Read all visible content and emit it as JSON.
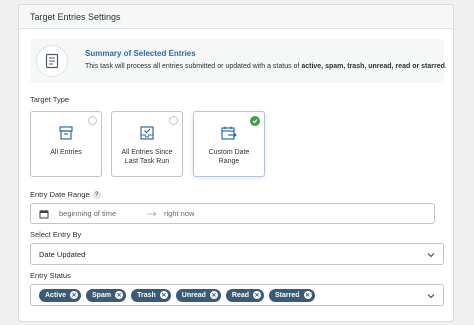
{
  "header": {
    "title": "Target Entries Settings"
  },
  "summary": {
    "title": "Summary of Selected Entries",
    "text_prefix": "This task will process all entries submitted or updated with a status of ",
    "statuses_text": "active, spam, trash, unread, read or starred",
    "text_suffix": "."
  },
  "target_type": {
    "label": "Target Type",
    "options": [
      {
        "label": "All Entries",
        "selected": false
      },
      {
        "label_line1": "All Entries Since",
        "label_line2": "Last Task Run",
        "selected": false
      },
      {
        "label": "Custom Date Range",
        "selected": true
      }
    ]
  },
  "date_range": {
    "label": "Entry Date Range",
    "help": "?",
    "start_placeholder": "beginning of time",
    "end_placeholder": "right now"
  },
  "select_entry_by": {
    "label": "Select Entry By",
    "value": "Date Updated"
  },
  "entry_status": {
    "label": "Entry Status",
    "tags": [
      "Active",
      "Spam",
      "Trash",
      "Unread",
      "Read",
      "Starred"
    ]
  },
  "colors": {
    "accent": "#2e6ca5",
    "tag_bg": "#3a5a75",
    "check_green": "#3fa047"
  }
}
